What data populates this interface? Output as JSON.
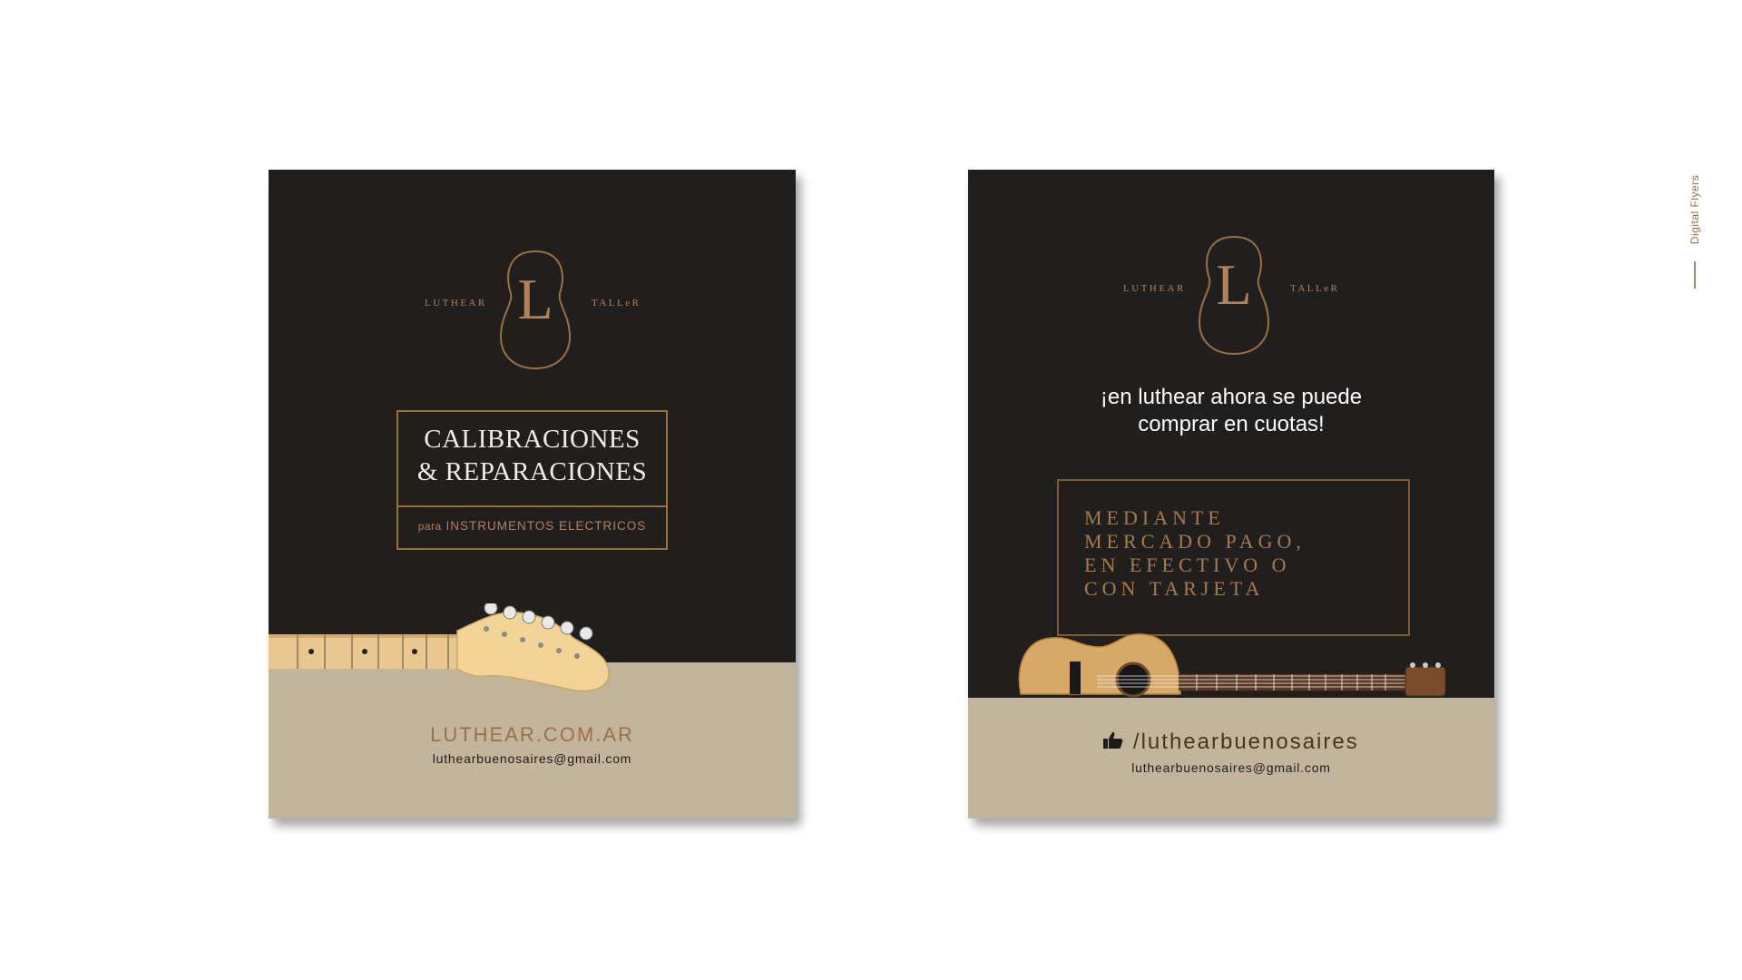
{
  "side_label": "Digital Flyers",
  "colors": {
    "dark": "#211f1e",
    "beige": "#c2b59b",
    "gold": "#b0835a"
  },
  "flyer1": {
    "logo": {
      "left": "LUTHEAR",
      "letter": "L",
      "right": "TALLeR"
    },
    "title_line1": "CALIBRACIONES",
    "title_line2": "& REPARACIONES",
    "subtitle_prefix": "para",
    "subtitle": "INSTRUMENTOS ELECTRICOS",
    "website": "LUTHEAR.COM.AR",
    "email": "luthearbuenosaires@gmail.com"
  },
  "flyer2": {
    "logo": {
      "left": "LUTHEAR",
      "letter": "L",
      "right": "TALLeR"
    },
    "headline_line1": "¡en luthear ahora se puede",
    "headline_line2": "comprar en cuotas!",
    "payment_lines": [
      "MEDIANTE",
      "MERCADO PAGO,",
      "EN EFECTIVO O",
      "CON TARJETA"
    ],
    "social_handle": "/luthearbuenosaires",
    "social_icon": "thumbs-up-icon",
    "email": "luthearbuenosaires@gmail.com"
  }
}
